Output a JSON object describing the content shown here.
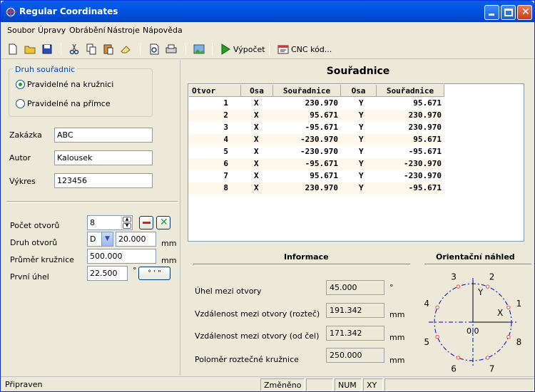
{
  "window": {
    "title": "Regular Coordinates"
  },
  "menu": [
    "Soubor",
    "Úpravy",
    "Obrábění",
    "Nástroje",
    "Nápověda"
  ],
  "toolbar": {
    "calc_label": "Výpočet",
    "cnc_label": "CNC kód..."
  },
  "hole_type_group": {
    "label": "Druh souřadnic",
    "options": [
      "Pravidelné na kružnici",
      "Pravidelné na přímce"
    ],
    "selected": 0
  },
  "meta": {
    "order_label": "Zakázka",
    "order_value": "ABC",
    "author_label": "Autor",
    "author_value": "Kalousek",
    "drawing_label": "Výkres",
    "drawing_value": "123456"
  },
  "params": {
    "count_label": "Počet otvorů",
    "count_value": "8",
    "type_label": "Druh otvorů",
    "type_value": "D",
    "type_size": "20.000",
    "type_unit": "mm",
    "diameter_label": "Průměr kružnice",
    "diameter_value": "500.000",
    "diameter_unit": "mm",
    "angle_label": "První úhel",
    "angle_value": "22.500",
    "angle_unit": "°",
    "angle_button": "° ' \""
  },
  "coordinates": {
    "title": "Souřadnice",
    "columns": [
      "Otvor",
      "Osa",
      "Souřadnice",
      "Osa",
      "Souřadnice"
    ],
    "rows": [
      [
        "1",
        "X",
        "230.970",
        "Y",
        "95.671"
      ],
      [
        "2",
        "X",
        "95.671",
        "Y",
        "230.970"
      ],
      [
        "3",
        "X",
        "-95.671",
        "Y",
        "230.970"
      ],
      [
        "4",
        "X",
        "-230.970",
        "Y",
        "95.671"
      ],
      [
        "5",
        "X",
        "-230.970",
        "Y",
        "-95.671"
      ],
      [
        "6",
        "X",
        "-95.671",
        "Y",
        "-230.970"
      ],
      [
        "7",
        "X",
        "95.671",
        "Y",
        "-230.970"
      ],
      [
        "8",
        "X",
        "230.970",
        "Y",
        "-95.671"
      ]
    ]
  },
  "info": {
    "title": "Informace",
    "angle_between_label": "Úhel mezi otvory",
    "angle_between_value": "45.000",
    "angle_between_unit": "°",
    "dist_pitch_label": "Vzdálenost mezi otvory (rozteč)",
    "dist_pitch_value": "191.342",
    "dist_pitch_unit": "mm",
    "dist_face_label": "Vzdálenost mezi otvory (od čel)",
    "dist_face_value": "171.342",
    "dist_face_unit": "mm",
    "radius_label": "Poloměr roztečné kružnice",
    "radius_value": "250.000",
    "radius_unit": "mm"
  },
  "preview": {
    "title": "Orientační náhled",
    "axis_y": "Y",
    "axis_x": "X",
    "origin": "0,0",
    "numbers": [
      "1",
      "2",
      "3",
      "4",
      "5",
      "6",
      "7",
      "8"
    ],
    "hole_color": "#FF4040"
  },
  "status": {
    "ready": "Připraven",
    "changed": "Změněno",
    "num": "NUM",
    "mode": "XY"
  }
}
